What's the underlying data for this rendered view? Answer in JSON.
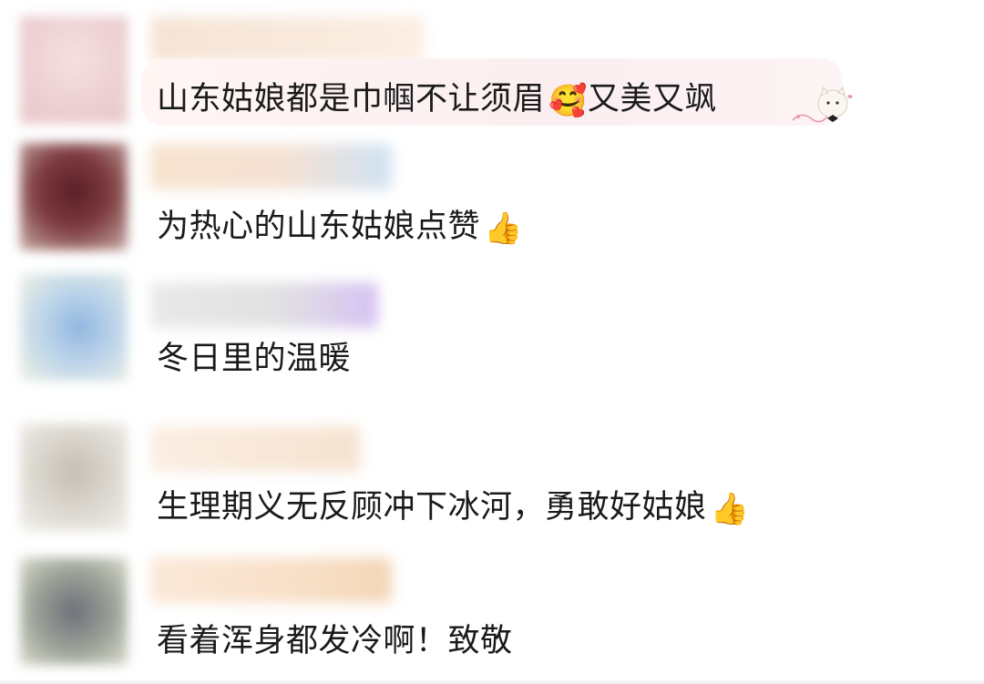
{
  "comments": [
    {
      "text": "山东姑娘都是巾帼不让须眉",
      "emoji": "🥰",
      "text_after": "又美又飒",
      "has_bubble_decoration": true,
      "avatar_colors": [
        "#f2d6d8",
        "#e8c4c6"
      ],
      "name_colors": [
        "#f6e4d6",
        "#fbeee2"
      ]
    },
    {
      "text": "为热心的山东姑娘点赞",
      "emoji": "👍",
      "avatar_colors": [
        "#6a2a32",
        "#b89890"
      ],
      "name_colors": [
        "#f7e3cf",
        "#cfe2f3"
      ]
    },
    {
      "text": "冬日里的温暖",
      "emoji": "",
      "avatar_colors": [
        "#9ec3e3",
        "#dfe9c8"
      ],
      "name_colors": [
        "#e6e6e6",
        "#d9c6f2"
      ]
    },
    {
      "text": "生理期义无反顾冲下冰河，勇敢好姑娘",
      "emoji": "👍",
      "avatar_colors": [
        "#d6d2c8",
        "#c9c2b6"
      ],
      "name_colors": [
        "#fbeee2",
        "#f7e3cf"
      ]
    },
    {
      "text": "看着浑身都发冷啊！致敬",
      "emoji": "",
      "avatar_colors": [
        "#7a7e88",
        "#c6cab8"
      ],
      "name_colors": [
        "#fbe8d8",
        "#f6dcc0"
      ]
    }
  ]
}
